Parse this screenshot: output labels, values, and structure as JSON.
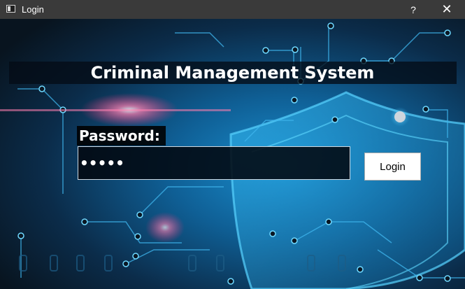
{
  "window": {
    "title": "Login",
    "help_label": "?",
    "close_label": "✕",
    "icon": "window-icon"
  },
  "header": {
    "title": "Criminal Management System"
  },
  "form": {
    "password_label": "Password:",
    "password_value": "•••••",
    "login_label": "Login"
  },
  "colors": {
    "titlebar": "#3a3a3a",
    "background_dark": "#0b1a2a",
    "accent_cyan": "#2fb4f0",
    "glow_pink": "#ff4d8a"
  }
}
